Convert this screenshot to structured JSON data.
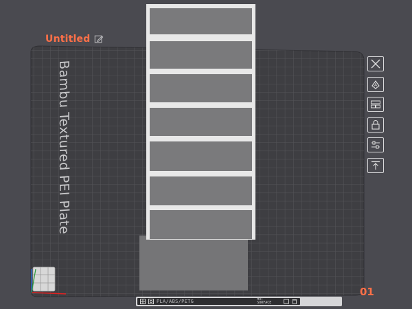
{
  "plate": {
    "title": "Untitled",
    "bed_type_label": "Bambu Textured PEI Plate",
    "plate_number": "01"
  },
  "info_bar": {
    "material": "PLA/ABS/PETG",
    "surface_line1": "HOT",
    "surface_line2": "SURFACE"
  },
  "icons": {
    "title_edit": "edit-icon",
    "tools": [
      "close-icon",
      "auto-orient-icon",
      "arrange-icon",
      "lock-icon",
      "settings-sliders-icon",
      "move-to-top-icon"
    ],
    "info": [
      "layout-icon",
      "scan-icon",
      "plate-icon",
      "trash-icon"
    ]
  },
  "colors": {
    "background": "#4a4a50",
    "bed": "#3f3f43",
    "grid_line": "#555559",
    "accent": "#ff7048",
    "object_fill": "#7a7a7c",
    "object_frame": "#e6e6e6"
  }
}
